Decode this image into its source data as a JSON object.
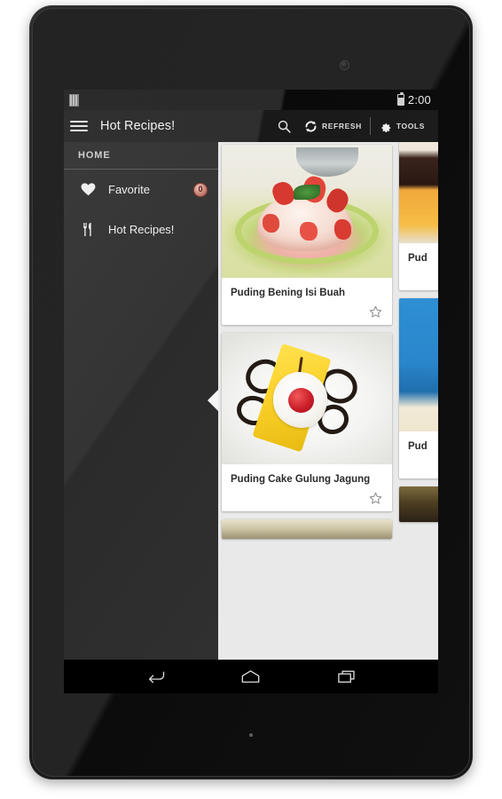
{
  "device": {
    "camera_icon": "front-camera",
    "led_icon": "notification-led"
  },
  "status_bar": {
    "notification_icon": "notification-indicator-icon",
    "battery_icon": "battery-icon",
    "time": "2:00"
  },
  "action_bar": {
    "drawer_toggle_icon": "hamburger-menu-icon",
    "title": "Hot Recipes!",
    "search_icon": "search-icon",
    "refresh_icon": "refresh-icon",
    "refresh_label": "REFRESH",
    "tools_icon": "gear-icon",
    "tools_label": "TOOLS"
  },
  "drawer": {
    "section_header": "HOME",
    "items": [
      {
        "label": "Favorite",
        "icon": "heart-icon",
        "badge": "0",
        "selected": false
      },
      {
        "label": "Hot Recipes!",
        "icon": "fork-and-knife-icon",
        "badge": null,
        "selected": true
      }
    ]
  },
  "content": {
    "column_left": [
      {
        "title": "",
        "photo": "cut-off-card-top",
        "star_icon": "star-outline-icon",
        "partial": true
      },
      {
        "title": "Puding Bening Isi Buah",
        "photo": "clear-pudding-with-fruit",
        "star_icon": "star-outline-icon",
        "partial": false
      },
      {
        "title": "Puding Cake Gulung Jagung",
        "photo": "corn-pudding-roll-cake",
        "star_icon": "star-outline-icon",
        "partial": false
      },
      {
        "title": "",
        "photo": "cut-off-card-bottom",
        "star_icon": null,
        "partial": true
      }
    ],
    "column_right": [
      {
        "title": "Pud",
        "photo": "chocolate-pudding-partial",
        "partial": true
      },
      {
        "title": "Pud",
        "photo": "blue-plate-pudding-partial",
        "partial": true
      },
      {
        "title": "",
        "photo": "dark-pudding-partial",
        "partial": true
      }
    ]
  },
  "nav_bar": {
    "back_icon": "back-arrow-icon",
    "home_icon": "home-icon",
    "recents_icon": "recent-apps-icon"
  },
  "colors": {
    "action_bar": "#2f2f2f",
    "drawer_bg": "#343434",
    "content_bg": "#e9e9e9",
    "card_bg": "#ffffff",
    "badge": "#a85a4c",
    "accent_text": "#f2f2f2"
  }
}
